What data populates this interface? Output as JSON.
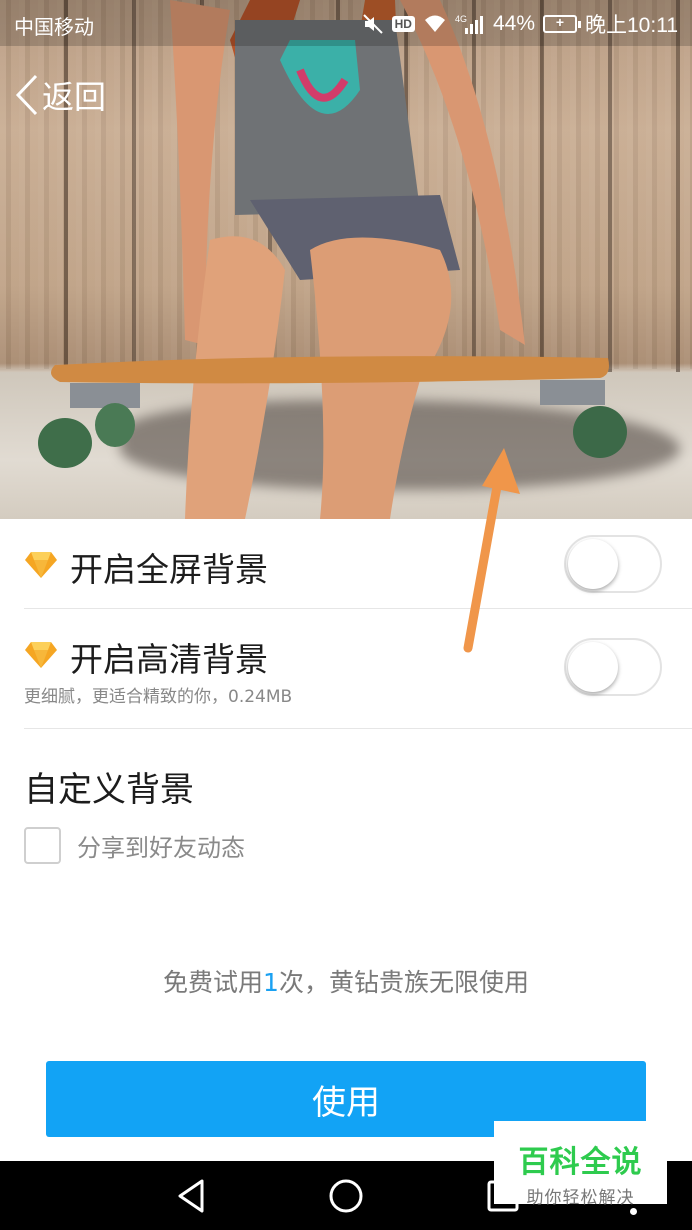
{
  "status_bar": {
    "carrier": "中国移动",
    "network": "4G",
    "battery": "44%",
    "time": "晚上10:11"
  },
  "header": {
    "back_label": "返回"
  },
  "settings": {
    "fullscreen": {
      "label": "开启全屏背景",
      "enabled": false
    },
    "hd": {
      "label": "开启高清背景",
      "description": "更细腻，更适合精致的你，0.24MB",
      "enabled": false
    }
  },
  "custom": {
    "title": "自定义背景",
    "share_label": "分享到好友动态",
    "share_checked": false
  },
  "trial": {
    "prefix": "免费试用",
    "count": "1",
    "suffix": "次，黄钻贵族无限使用"
  },
  "action": {
    "use_label": "使用"
  },
  "watermark": {
    "main": "百科全说",
    "sub": "助你轻松解决"
  },
  "colors": {
    "accent": "#12a3f5",
    "diamond": "#f5a623",
    "annotation_arrow": "#f0964a",
    "watermark": "#2ecb4e"
  },
  "icons": [
    "back-chevron-icon",
    "diamond-icon",
    "mute-icon",
    "wifi-icon",
    "signal-icon",
    "battery-icon",
    "nav-back-icon",
    "nav-home-icon",
    "nav-recent-icon"
  ]
}
